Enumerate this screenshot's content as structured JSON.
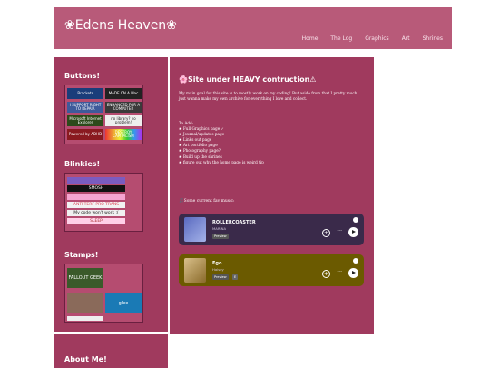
{
  "header": {
    "title": "❀Edens Heaven❀",
    "nav": [
      "Home",
      "The Log",
      "Graphics",
      "Art",
      "Shrines"
    ]
  },
  "sidebar": {
    "buttons_heading": "Buttons!",
    "buttons": [
      "Brackets",
      "MADE ON A Mac",
      "I SUPPORT RIGHT TO REPAIR",
      "ENHANCED FOR A COMPUTER",
      "Microsoft Internet Explorer",
      "no library? no problem!",
      "Powered by ADHD",
      "DESTROY CAPITALISM"
    ],
    "blinkies_heading": "Blinkies!",
    "blinkies": [
      "",
      "SMOSH",
      "",
      "ANTI-TERF PRO-TRANS",
      "My code won't work :(",
      "SLEEP"
    ],
    "stamps_heading": "Stamps!",
    "stamps": [
      "FALLOUT GEEK",
      "",
      "glee",
      ""
    ],
    "about_heading": "About Me!"
  },
  "main": {
    "heading": "Site under HEAVY contruction",
    "intro": "My main goal for this site is to mostly work on my coding! But aside from that I pretty much just wanna make my own archive for everything I love and collect.",
    "todo_title": "To Add:",
    "todo": [
      "Full Graphics page ✓",
      "Journal/updates page",
      "Links out page",
      "Art portfolio page",
      "Photography page?",
      "Build up the shrines",
      "figure out why the home page is weird tip"
    ],
    "music_label": "Some current fav music:",
    "tracks": [
      {
        "title": "ROLLERCOASTER",
        "artist": "MARINA",
        "preview": "Preview",
        "explicit": ""
      },
      {
        "title": "Ego",
        "artist": "Halsey",
        "preview": "Preview",
        "explicit": "E"
      }
    ]
  },
  "colors": {
    "header": "#b85a79",
    "panel": "#a03a5e",
    "track1": "#3a2a4a",
    "track2": "#6b5a00"
  }
}
